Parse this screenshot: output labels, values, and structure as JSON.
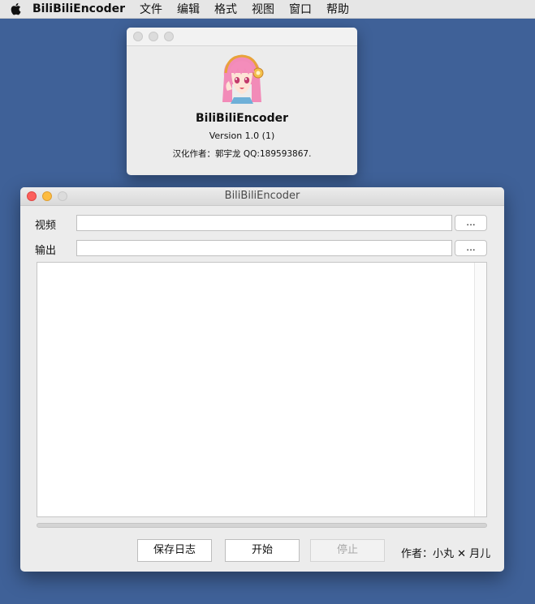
{
  "menubar": {
    "app_name": "BiliBiliEncoder",
    "items": [
      "文件",
      "编辑",
      "格式",
      "视图",
      "窗口",
      "帮助"
    ]
  },
  "about_window": {
    "title": "BiliBiliEncoder",
    "version": "Version 1.0 (1)",
    "credit": "汉化作者：郭宇龙 QQ:189593867."
  },
  "main_window": {
    "title": "BiliBiliEncoder",
    "video_label": "视频",
    "video_value": "",
    "output_label": "输出",
    "output_value": "",
    "browse_label": "...",
    "log_text": "",
    "progress": 0,
    "buttons": {
      "save_log": "保存日志",
      "start": "开始",
      "stop": "停止"
    },
    "author": "作者：小丸 ✕ 月儿"
  },
  "colors": {
    "desktop": "#3f6198",
    "close": "#fc605c",
    "minimize": "#fdbc40"
  },
  "icons": {
    "apple": "apple-logo-icon",
    "app_avatar": "anime-girl-avatar-icon"
  }
}
